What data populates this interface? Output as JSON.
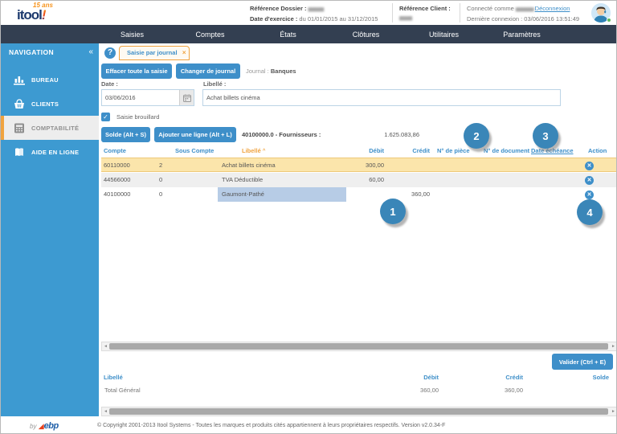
{
  "header": {
    "logo_top": "15 ans",
    "logo_brand": "itool",
    "logo_excl": "!",
    "dossier_label": "Référence Dossier :",
    "dossier_value_redacted": "▆▆▆ ▆▆",
    "exercice_label": "Date d'exercice :",
    "exercice_value": "du 01/01/2015 au 31/12/2015",
    "client_label": "Référence Client :",
    "client_value_redacted": "▆▆ ▆▆",
    "connected_prefix": "Connecté comme",
    "connected_user_redacted": "▆▆▆▆▆▆",
    "logout_label": "Déconnexion",
    "last_connection": "Dernière connexion : 03/06/2016 13:51:49"
  },
  "navbar": {
    "items": [
      {
        "label": "Saisies"
      },
      {
        "label": "Comptes"
      },
      {
        "label": "États"
      },
      {
        "label": "Clôtures"
      },
      {
        "label": "Utilitaires"
      },
      {
        "label": "Paramètres"
      }
    ]
  },
  "sidebar": {
    "title": "NAVIGATION",
    "collapse_icon": "«",
    "items": [
      {
        "label": "BUREAU",
        "icon": "bar-chart-icon",
        "active": false
      },
      {
        "label": "CLIENTS",
        "icon": "basket-icon",
        "active": false
      },
      {
        "label": "COMPTABILITÉ",
        "icon": "calculator-icon",
        "active": true
      },
      {
        "label": "AIDE EN LIGNE",
        "icon": "book-icon",
        "active": false
      }
    ]
  },
  "tabbar": {
    "help_icon": "?",
    "tab_label": "Saisie par journal",
    "tab_close": "×"
  },
  "toolbar": {
    "clear_button": "Effacer toute la saisie",
    "change_journal_button": "Changer de journal",
    "journal_label": "Journal :",
    "journal_value": "Banques"
  },
  "form": {
    "date_label": "Date :",
    "date_value": "03/06/2016",
    "libelle_label": "Libellé :",
    "libelle_value": "Achat billets cinéma",
    "draft_checkbox_label": "Saisie brouillard",
    "draft_checked": true
  },
  "entry_toolbar": {
    "solde_button": "Solde (Alt + S)",
    "add_line_button": "Ajouter une ligne (Alt + L)",
    "account_label": "40100000.0 - Fournisseurs :",
    "account_balance": "1.625.083,86"
  },
  "entry_table": {
    "columns": {
      "compte": "Compte",
      "sous_compte": "Sous Compte",
      "libelle": "Libellé",
      "debit": "Débit",
      "credit": "Crédit",
      "piece": "N° de pièce",
      "document": "N° de document",
      "echeance": "Date échéance",
      "action": "Action"
    },
    "sort_column": "Libellé",
    "sort_indicator": "^",
    "rows": [
      {
        "compte": "60110000",
        "sous_compte": "2",
        "libelle": "Achat billets cinéma",
        "debit": "300,00",
        "credit": "",
        "piece": "",
        "document": "",
        "echeance": "",
        "highlighted": true
      },
      {
        "compte": "44566000",
        "sous_compte": "0",
        "libelle": "TVA Déductible",
        "debit": "60,00",
        "credit": "",
        "piece": "",
        "document": "",
        "echeance": "",
        "highlighted": false
      },
      {
        "compte": "40100000",
        "sous_compte": "0",
        "libelle": "Gaumont-Pathé",
        "debit": "",
        "credit": "360,00",
        "piece": "",
        "document": "",
        "echeance": "",
        "selected_cell": "libelle"
      }
    ]
  },
  "annotations": [
    {
      "number": "1"
    },
    {
      "number": "2"
    },
    {
      "number": "3"
    },
    {
      "number": "4"
    }
  ],
  "validate_button": "Valider (Ctrl + E)",
  "totals": {
    "columns": {
      "libelle": "Libellé",
      "debit": "Débit",
      "credit": "Crédit",
      "solde": "Solde"
    },
    "row": {
      "libelle": "Total Général",
      "debit": "360,00",
      "credit": "360,00",
      "solde": ""
    }
  },
  "footer": {
    "by": "by",
    "ebp": "ebp",
    "copyright": "© Copyright 2001-2013 Itool Systems - Toutes les marques et produits cités appartiennent à leurs propriétaires respectifs. Version v2.0.34-F"
  },
  "icons": {
    "delete": "✕",
    "check": "✓",
    "scroll_left": "◄",
    "scroll_right": "►"
  },
  "colors": {
    "sidebar_blue": "#3d9ad1",
    "navbar_dark": "#333f51",
    "button_blue": "#3e8fc9",
    "accent_orange": "#f0a33f",
    "row_highlight": "#fbe5ab",
    "selected_cell": "#b7cce6",
    "annotation_circle": "#3a86b8"
  }
}
